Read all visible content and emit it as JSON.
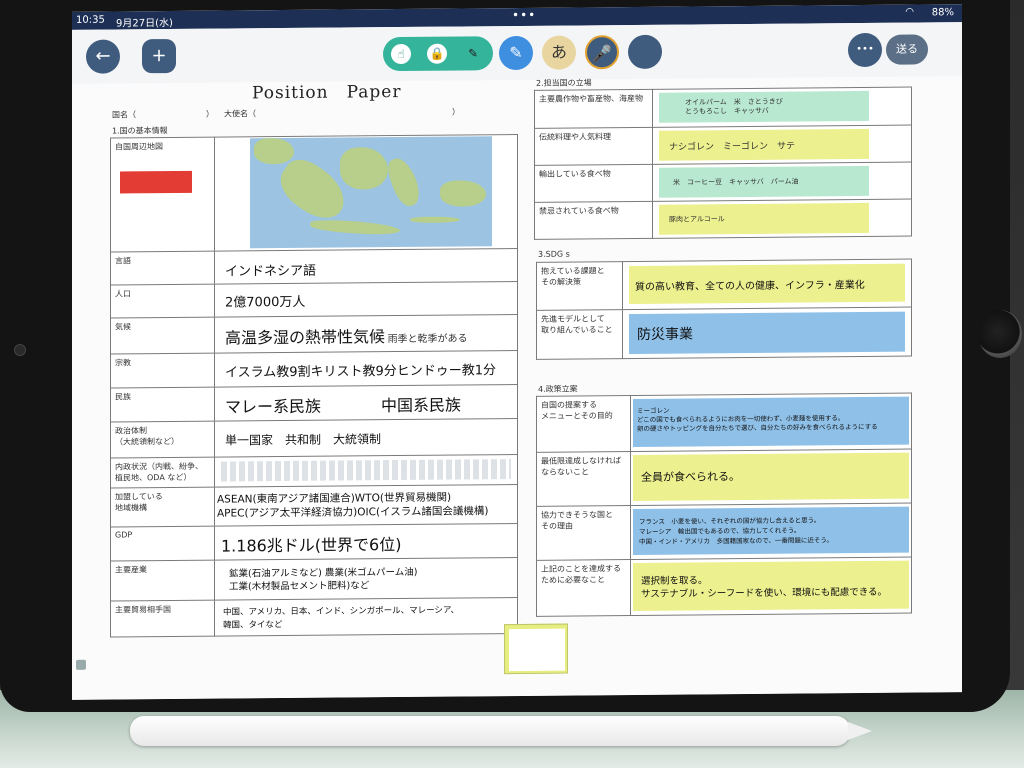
{
  "status": {
    "time": "10:35",
    "date": "9月27日(水)",
    "battery": "88%",
    "multitask_dots": "•••"
  },
  "toolbar": {
    "back_glyph": "←",
    "add_glyph": "+",
    "tool_glyphs": [
      "☝",
      "🔒",
      "✎"
    ],
    "pen_glyph": "✎",
    "text_glyph": "あ",
    "mic_glyph": "🎤",
    "more_glyph": "•••",
    "send_label": "送る",
    "colors": {
      "accent": "#34b49b",
      "button": "#3f5b7e",
      "pen": "#3f8fe0",
      "mic": "#3f5b7e"
    }
  },
  "doc": {
    "title": "Position　Paper",
    "country_label": "国名（",
    "country_close": "）",
    "ambassador_label": "大使名（",
    "ambassador_close": "）",
    "section1_title": "1.国の基本情報",
    "map_label": "自国周辺地図",
    "basic_rows": [
      {
        "label": "言語",
        "value": "インドネシア語"
      },
      {
        "label": "人口",
        "value": "2億7000万人"
      },
      {
        "label": "気候",
        "value": "高温多湿の熱帯性気候",
        "note": "雨季と乾季がある"
      },
      {
        "label": "宗教",
        "value": "イスラム教9割キリスト教9分ヒンドゥー教1分"
      },
      {
        "label": "民族",
        "value": "マレー系民族",
        "value2": "中国系民族"
      },
      {
        "label": "政治体制",
        "label2": "（大統領制など）",
        "value": "単一国家　共和制　大統領制"
      },
      {
        "label": "内政状況（内戦、紛争、",
        "label2": "植民地、ODA など）",
        "value": ""
      },
      {
        "label": "加盟している",
        "label2": "地域機構",
        "value": "ASEAN(東南アジア諸国連合)WTO(世界貿易機関)",
        "value2": "APEC(アジア太平洋経済協力)OIC(イスラム諸国会議機構)"
      },
      {
        "label": "GDP",
        "value": "1.186兆ドル(世界で6位)"
      },
      {
        "label": "主要産業",
        "value": "鉱業(石油アルミなど) 農業(米ゴムパーム油)",
        "value2": "工業(木材製品セメント肥料)など"
      },
      {
        "label": "主要貿易相手国",
        "value": "中国、アメリカ、日本、インド、シンガポール、マレーシア、",
        "value2": "韓国、タイなど"
      }
    ],
    "section2_title": "2.担当国の立場",
    "position_rows": [
      {
        "label": "主要農作物や畜産物、海産物",
        "value": "オイルパーム　米　さとうきび",
        "value2": "とうもろこし　キャッサバ"
      },
      {
        "label": "伝統料理や人気料理",
        "value": "ナシゴレン　ミーゴレン　サテ"
      },
      {
        "label": "輸出している食べ物",
        "value": "米　コーヒー豆　キャッサバ　パーム油"
      },
      {
        "label": "禁忌されている食べ物",
        "value": "豚肉とアルコール"
      }
    ],
    "section3_title": "3.SDG s",
    "sdg_rows": [
      {
        "label": "抱えている課題と",
        "label2": "その解決策",
        "value": "質の高い教育、全ての人の健康、インフラ・産業化"
      },
      {
        "label": "先進モデルとして",
        "label2": "取り組んでいること",
        "value": "防災事業"
      }
    ],
    "section4_title": "4.政策立案",
    "policy_rows": [
      {
        "label": "自国の提案する",
        "label2": "メニューとその目的",
        "value": "ミーゴレン",
        "value2": "どこの国でも食べられるようにお肉を一切使わず、小麦麺を使用する。",
        "value3": "卵の硬さやトッピングを自分たちで選び、自分たちの好みを食べられるようにする"
      },
      {
        "label": "最低限達成しなければ",
        "label2": "ならないこと",
        "value": "全員が食べられる。"
      },
      {
        "label": "協力できそうな国と",
        "label2": "その理由",
        "value": "フランス　小麦を使い、それぞれの国が協力し合えると思う。",
        "value2": "マレーシア　輸出国でもあるので、協力してくれそう。",
        "value3": "中国・インド・アメリカ　多国籍国家なので、一番問題に近そう。"
      },
      {
        "label": "上記のことを達成する",
        "label2": "ために必要なこと",
        "value": "選択制を取る。",
        "value2": "サステナブル・シーフードを使い、環境にも配慮できる。"
      }
    ]
  }
}
